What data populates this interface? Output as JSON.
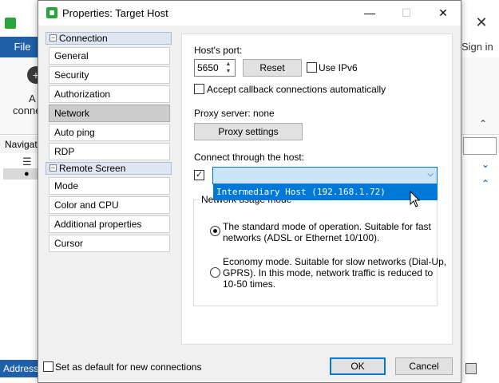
{
  "background_app": {
    "file_tab": "File",
    "sign_in": "Sign in",
    "add_label": "A",
    "conn_label": "conne",
    "navigation_label": "Navigati",
    "address_label": "Address:",
    "close_glyph": "✕"
  },
  "dialog": {
    "title": "Properties: Target Host",
    "minimize_glyph": "—",
    "maximize_glyph": "☐",
    "close_glyph": "✕",
    "nav": {
      "groups": [
        {
          "label": "Connection",
          "items": [
            "General",
            "Security",
            "Authorization",
            "Network",
            "Auto ping",
            "RDP"
          ]
        },
        {
          "label": "Remote Screen",
          "items": [
            "Mode",
            "Color and CPU",
            "Additional properties",
            "Cursor"
          ]
        }
      ],
      "selected": "Network"
    },
    "panel": {
      "port_label": "Host's port:",
      "port_value": "5650",
      "reset_button": "Reset",
      "ipv6_label": "Use IPv6",
      "ipv6_checked": false,
      "callback_label": "Accept callback connections automatically",
      "callback_checked": false,
      "proxy_label": "Proxy server: none",
      "proxy_button": "Proxy settings",
      "connect_through_label": "Connect through the host:",
      "connect_through_checked": true,
      "connect_through_value": "",
      "dropdown_option": "Intermediary Host (192.168.1.72)",
      "usage_mode_title": "Network usage mode",
      "modes": [
        {
          "lines": [
            "The standard mode of operation. Suitable for fast",
            "networks (ADSL or Ethernet 10/100)."
          ],
          "selected": true
        },
        {
          "lines": [
            "Economy mode. Suitable for slow networks (Dial-Up,",
            "GPRS). In this mode, network traffic is reduced to",
            "10-50 times."
          ],
          "selected": false
        }
      ]
    },
    "footer": {
      "default_checkbox_label": "Set as default for new connections",
      "default_checked": false,
      "ok_button": "OK",
      "cancel_button": "Cancel"
    }
  },
  "colors": {
    "accent": "#0078d7",
    "selection_bg": "#cce4f7",
    "nav_selected": "#cccccc",
    "app_brand": "#1e5fa8",
    "icon_green": "#29a33a"
  }
}
